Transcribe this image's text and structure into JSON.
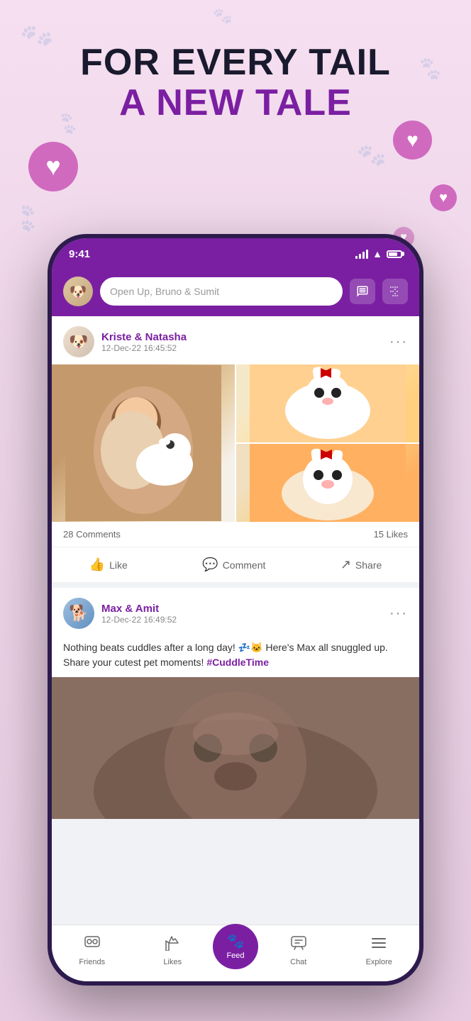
{
  "hero": {
    "line1": "FOR EVERY TAIL",
    "line2": "A NEW TALE"
  },
  "status_bar": {
    "time": "9:41"
  },
  "search_bar": {
    "placeholder": "Open Up, Bruno & Sumit"
  },
  "posts": [
    {
      "id": "post1",
      "author": "Kriste & Natasha",
      "time": "12-Dec-22 16:45:52",
      "comments_count": "28 Comments",
      "likes_count": "15 Likes",
      "actions": {
        "like": "Like",
        "comment": "Comment",
        "share": "Share"
      }
    },
    {
      "id": "post2",
      "author": "Max & Amit",
      "time": "12-Dec-22 16:49:52",
      "text": "Nothing beats cuddles after a long day! 💤🐱\nHere's Max all snuggled up. Share your cutest pet moments!",
      "hashtag": "#CuddleTime"
    }
  ],
  "bottom_nav": {
    "items": [
      {
        "label": "Friends",
        "icon": "🐾"
      },
      {
        "label": "Likes",
        "icon": "👍"
      },
      {
        "label": "Feed",
        "icon": "🐾"
      },
      {
        "label": "Chat",
        "icon": "💬"
      },
      {
        "label": "Explore",
        "icon": "☰"
      }
    ]
  }
}
